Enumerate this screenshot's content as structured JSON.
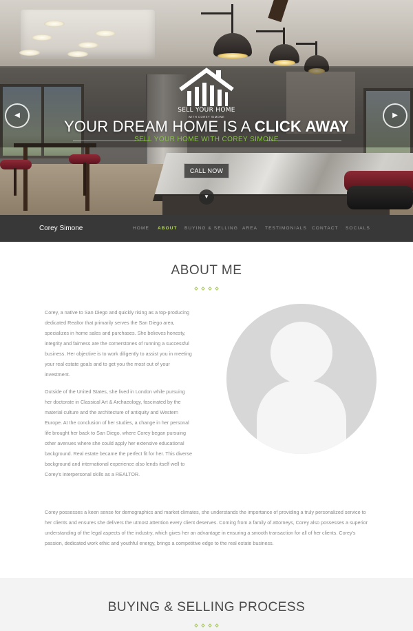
{
  "hero": {
    "logo_title": "SELL YOUR HOME",
    "logo_subtitle": "WITH COREY SIMONE",
    "headline_prefix": "YOUR DREAM HOME IS A ",
    "headline_emphasis": "CLICK AWAY",
    "tagline": "SELL YOUR HOME WITH COREY SIMONE",
    "cta_label": "CALL NOW",
    "prev_icon": "chevron-left-icon",
    "next_icon": "chevron-right-icon",
    "scroll_icon": "chevron-down-icon"
  },
  "nav": {
    "brand": "Corey Simone",
    "items": [
      {
        "label": "HOME",
        "active": false
      },
      {
        "label": "ABOUT",
        "active": true
      },
      {
        "label": "BUYING & SELLING",
        "active": false
      },
      {
        "label": "AREA",
        "active": false
      },
      {
        "label": "TESTIMONIALS",
        "active": false
      },
      {
        "label": "CONTACT",
        "active": false
      },
      {
        "label": "SOCIALS",
        "active": false
      }
    ]
  },
  "about": {
    "title": "ABOUT ME",
    "paragraphs": [
      "Corey, a native to San Diego and quickly rising as a top-producing dedicated Realtor that primarily serves the San Diego area, specializes in home sales and purchases. She believes honesty, integrity and fairness are the cornerstones of running a successful business. Her objective is to work diligently to assist you in meeting your real estate goals and to get you the most out of your investment.",
      "Outside of the United States, she lived in London while pursuing her doctorate in Classical Art & Archaeology, fascinated by the material culture and the architecture of antiquity and Western Europe. At the conclusion of her studies, a change in her personal life brought her back to San Diego, where Corey began pursuing other avenues where she could apply her extensive educational background. Real estate became the perfect fit for her. This diverse background and international experience also lends itself well to Corey's interpersonal skills as a REALTOR.",
      "Corey possesses a keen sense for demographics and market climates, she understands the importance of providing a truly personalized service to her clients and ensures she delivers the utmost attention every client deserves. Coming from a family of attorneys, Corey also possesses a superior understanding of the legal aspects of the industry, which gives her an advantage in ensuring a smooth transaction for all of her clients. Corey's passion, dedicated work ethic and youthful energy, brings a competitive edge to the real estate business."
    ],
    "avatar_icon": "user-placeholder-icon"
  },
  "process": {
    "title": "BUYING & SELLING PROCESS"
  },
  "colors": {
    "accent": "#8bc34a",
    "nav_active": "#b5d85d",
    "navbar_bg": "#383838"
  }
}
